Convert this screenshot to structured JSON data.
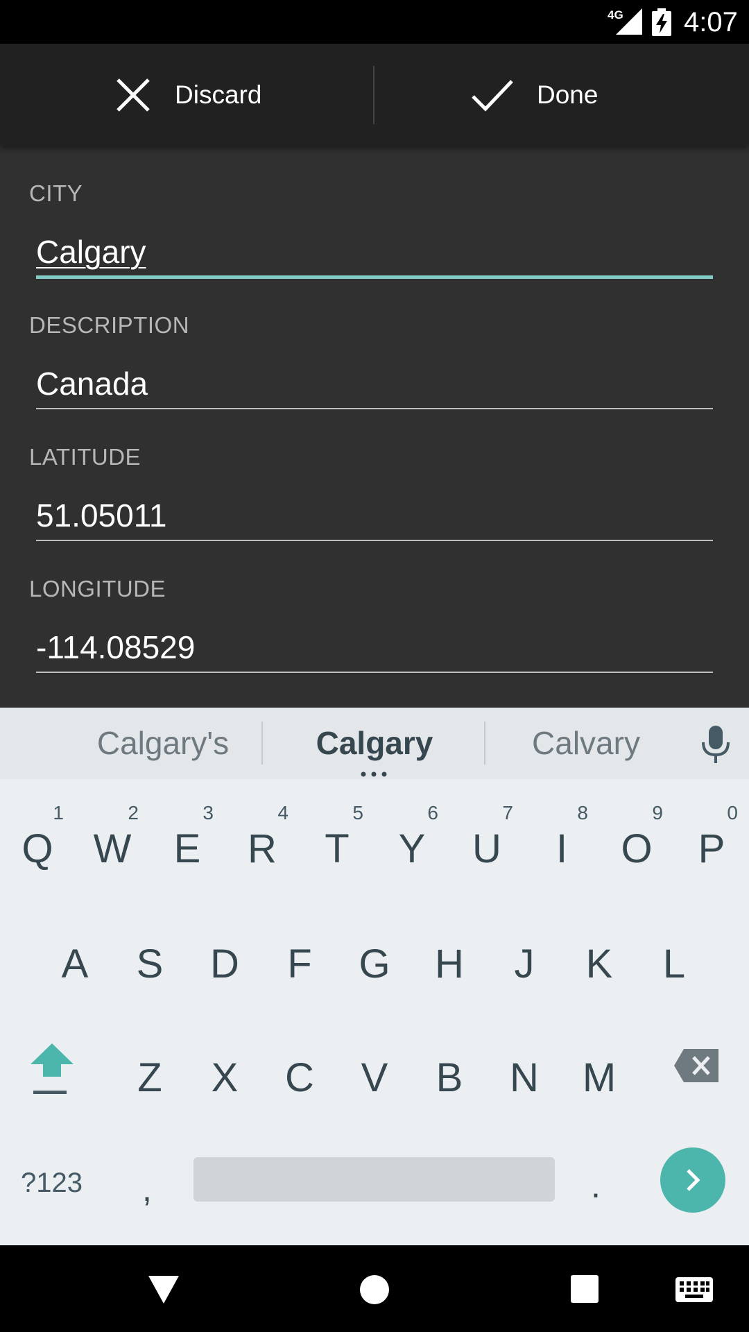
{
  "status_bar": {
    "network": "4G",
    "time": "4:07"
  },
  "action_bar": {
    "discard_label": "Discard",
    "done_label": "Done"
  },
  "form": {
    "city": {
      "label": "CITY",
      "value": "Calgary"
    },
    "description": {
      "label": "DESCRIPTION",
      "value": "Canada"
    },
    "latitude": {
      "label": "LATITUDE",
      "value": "51.05011"
    },
    "longitude": {
      "label": "LONGITUDE",
      "value": "-114.08529"
    }
  },
  "keyboard": {
    "suggestions": [
      "Calgary's",
      "Calgary",
      "Calvary"
    ],
    "row1": [
      {
        "key": "Q",
        "hint": "1"
      },
      {
        "key": "W",
        "hint": "2"
      },
      {
        "key": "E",
        "hint": "3"
      },
      {
        "key": "R",
        "hint": "4"
      },
      {
        "key": "T",
        "hint": "5"
      },
      {
        "key": "Y",
        "hint": "6"
      },
      {
        "key": "U",
        "hint": "7"
      },
      {
        "key": "I",
        "hint": "8"
      },
      {
        "key": "O",
        "hint": "9"
      },
      {
        "key": "P",
        "hint": "0"
      }
    ],
    "row2": [
      "A",
      "S",
      "D",
      "F",
      "G",
      "H",
      "J",
      "K",
      "L"
    ],
    "row3": [
      "Z",
      "X",
      "C",
      "V",
      "B",
      "N",
      "M"
    ],
    "symbols_label": "?123",
    "comma": ",",
    "period": ".",
    "accent_color": "#4db6ac"
  },
  "icons": {
    "discard": "close-icon",
    "done": "check-icon",
    "mic": "microphone-icon",
    "shift": "shift-icon",
    "delete": "backspace-icon",
    "go": "chevron-right-icon",
    "nav_back": "back-triangle-icon",
    "nav_home": "home-circle-icon",
    "nav_recents": "recents-square-icon",
    "nav_keyboard": "keyboard-icon"
  }
}
